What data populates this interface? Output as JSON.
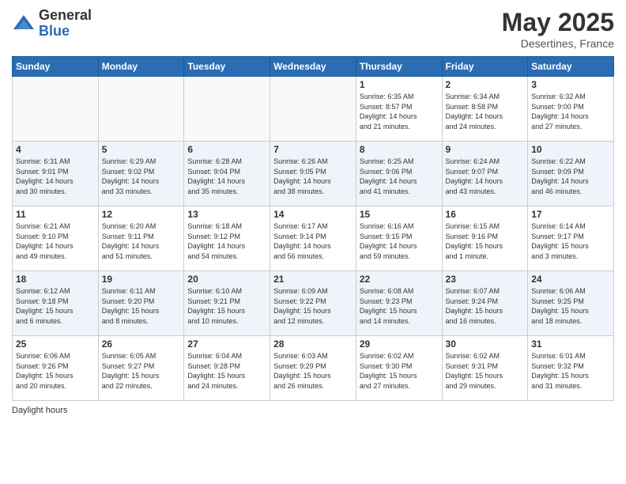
{
  "logo": {
    "general": "General",
    "blue": "Blue"
  },
  "title": "May 2025",
  "location": "Desertines, France",
  "days_of_week": [
    "Sunday",
    "Monday",
    "Tuesday",
    "Wednesday",
    "Thursday",
    "Friday",
    "Saturday"
  ],
  "weeks": [
    [
      {
        "day": "",
        "info": ""
      },
      {
        "day": "",
        "info": ""
      },
      {
        "day": "",
        "info": ""
      },
      {
        "day": "",
        "info": ""
      },
      {
        "day": "1",
        "info": "Sunrise: 6:35 AM\nSunset: 8:57 PM\nDaylight: 14 hours\nand 21 minutes."
      },
      {
        "day": "2",
        "info": "Sunrise: 6:34 AM\nSunset: 8:58 PM\nDaylight: 14 hours\nand 24 minutes."
      },
      {
        "day": "3",
        "info": "Sunrise: 6:32 AM\nSunset: 9:00 PM\nDaylight: 14 hours\nand 27 minutes."
      }
    ],
    [
      {
        "day": "4",
        "info": "Sunrise: 6:31 AM\nSunset: 9:01 PM\nDaylight: 14 hours\nand 30 minutes."
      },
      {
        "day": "5",
        "info": "Sunrise: 6:29 AM\nSunset: 9:02 PM\nDaylight: 14 hours\nand 33 minutes."
      },
      {
        "day": "6",
        "info": "Sunrise: 6:28 AM\nSunset: 9:04 PM\nDaylight: 14 hours\nand 35 minutes."
      },
      {
        "day": "7",
        "info": "Sunrise: 6:26 AM\nSunset: 9:05 PM\nDaylight: 14 hours\nand 38 minutes."
      },
      {
        "day": "8",
        "info": "Sunrise: 6:25 AM\nSunset: 9:06 PM\nDaylight: 14 hours\nand 41 minutes."
      },
      {
        "day": "9",
        "info": "Sunrise: 6:24 AM\nSunset: 9:07 PM\nDaylight: 14 hours\nand 43 minutes."
      },
      {
        "day": "10",
        "info": "Sunrise: 6:22 AM\nSunset: 9:09 PM\nDaylight: 14 hours\nand 46 minutes."
      }
    ],
    [
      {
        "day": "11",
        "info": "Sunrise: 6:21 AM\nSunset: 9:10 PM\nDaylight: 14 hours\nand 49 minutes."
      },
      {
        "day": "12",
        "info": "Sunrise: 6:20 AM\nSunset: 9:11 PM\nDaylight: 14 hours\nand 51 minutes."
      },
      {
        "day": "13",
        "info": "Sunrise: 6:18 AM\nSunset: 9:12 PM\nDaylight: 14 hours\nand 54 minutes."
      },
      {
        "day": "14",
        "info": "Sunrise: 6:17 AM\nSunset: 9:14 PM\nDaylight: 14 hours\nand 56 minutes."
      },
      {
        "day": "15",
        "info": "Sunrise: 6:16 AM\nSunset: 9:15 PM\nDaylight: 14 hours\nand 59 minutes."
      },
      {
        "day": "16",
        "info": "Sunrise: 6:15 AM\nSunset: 9:16 PM\nDaylight: 15 hours\nand 1 minute."
      },
      {
        "day": "17",
        "info": "Sunrise: 6:14 AM\nSunset: 9:17 PM\nDaylight: 15 hours\nand 3 minutes."
      }
    ],
    [
      {
        "day": "18",
        "info": "Sunrise: 6:12 AM\nSunset: 9:18 PM\nDaylight: 15 hours\nand 6 minutes."
      },
      {
        "day": "19",
        "info": "Sunrise: 6:11 AM\nSunset: 9:20 PM\nDaylight: 15 hours\nand 8 minutes."
      },
      {
        "day": "20",
        "info": "Sunrise: 6:10 AM\nSunset: 9:21 PM\nDaylight: 15 hours\nand 10 minutes."
      },
      {
        "day": "21",
        "info": "Sunrise: 6:09 AM\nSunset: 9:22 PM\nDaylight: 15 hours\nand 12 minutes."
      },
      {
        "day": "22",
        "info": "Sunrise: 6:08 AM\nSunset: 9:23 PM\nDaylight: 15 hours\nand 14 minutes."
      },
      {
        "day": "23",
        "info": "Sunrise: 6:07 AM\nSunset: 9:24 PM\nDaylight: 15 hours\nand 16 minutes."
      },
      {
        "day": "24",
        "info": "Sunrise: 6:06 AM\nSunset: 9:25 PM\nDaylight: 15 hours\nand 18 minutes."
      }
    ],
    [
      {
        "day": "25",
        "info": "Sunrise: 6:06 AM\nSunset: 9:26 PM\nDaylight: 15 hours\nand 20 minutes."
      },
      {
        "day": "26",
        "info": "Sunrise: 6:05 AM\nSunset: 9:27 PM\nDaylight: 15 hours\nand 22 minutes."
      },
      {
        "day": "27",
        "info": "Sunrise: 6:04 AM\nSunset: 9:28 PM\nDaylight: 15 hours\nand 24 minutes."
      },
      {
        "day": "28",
        "info": "Sunrise: 6:03 AM\nSunset: 9:29 PM\nDaylight: 15 hours\nand 26 minutes."
      },
      {
        "day": "29",
        "info": "Sunrise: 6:02 AM\nSunset: 9:30 PM\nDaylight: 15 hours\nand 27 minutes."
      },
      {
        "day": "30",
        "info": "Sunrise: 6:02 AM\nSunset: 9:31 PM\nDaylight: 15 hours\nand 29 minutes."
      },
      {
        "day": "31",
        "info": "Sunrise: 6:01 AM\nSunset: 9:32 PM\nDaylight: 15 hours\nand 31 minutes."
      }
    ]
  ],
  "footer": "Daylight hours"
}
